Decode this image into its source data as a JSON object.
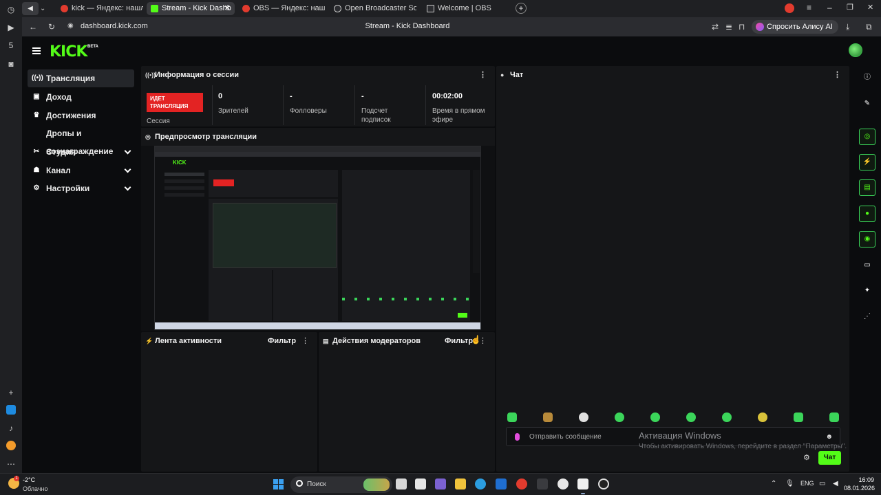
{
  "browser": {
    "tabs": [
      {
        "label": "kick — Яндекс: нашлось 1",
        "active": false
      },
      {
        "label": "Stream - Kick Dashb",
        "active": true
      },
      {
        "label": "OBS — Яндекс: нашлось 3",
        "active": false
      },
      {
        "label": "Open Broadcaster Softwa",
        "active": false
      },
      {
        "label": "Welcome | OBS",
        "active": false
      }
    ],
    "url": "dashboard.kick.com",
    "page_title": "Stream - Kick Dashboard",
    "alice_button": "Спросить Алису AI"
  },
  "header": {
    "logo": "KICK",
    "logo_badge": "BETA"
  },
  "sidebar": {
    "items": [
      {
        "label": "Трансляция",
        "icon": "broadcast-icon",
        "active": true,
        "expandable": false
      },
      {
        "label": "Доход",
        "icon": "revenue-icon",
        "active": false,
        "expandable": false
      },
      {
        "label": "Достижения",
        "icon": "trophy-icon",
        "active": false,
        "expandable": false
      },
      {
        "label": "Дропы и вознаграждение",
        "icon": "",
        "active": false,
        "expandable": false
      },
      {
        "label": "Студия",
        "icon": "studio-icon",
        "active": false,
        "expandable": true
      },
      {
        "label": "Канал",
        "icon": "channel-icon",
        "active": false,
        "expandable": true
      },
      {
        "label": "Настройки",
        "icon": "settings-icon",
        "active": false,
        "expandable": true
      }
    ]
  },
  "session": {
    "title": "Информация о сессии",
    "live_badge": "ИДЕТ ТРАНСЛЯЦИЯ",
    "session_label": "Сессия",
    "stats": [
      {
        "value": "0",
        "label": "Зрителей"
      },
      {
        "value": "-",
        "label": "Фолловеры"
      },
      {
        "value": "-",
        "label": "Подсчет подписок"
      },
      {
        "value": "00:02:00",
        "label": "Время в прямом эфире"
      }
    ]
  },
  "preview": {
    "title": "Предпросмотр трансляции"
  },
  "activity": {
    "title": "Лента активности",
    "filter": "Фильтр"
  },
  "moderators": {
    "title": "Действия модераторов",
    "filter": "Фильтр"
  },
  "chat": {
    "title": "Чат",
    "input_placeholder": "Отправить сообщение",
    "send_label": "Чат"
  },
  "windows_watermark": {
    "title": "Активация Windows",
    "subtitle": "Чтобы активировать Windows, перейдите в раздел \"Параметры\"."
  },
  "taskbar": {
    "weather_temp": "-2°C",
    "weather_desc": "Облачно",
    "weather_badge": "1",
    "search_label": "Поиск",
    "lang": "ENG",
    "time": "16:09",
    "date": "08.01.2026"
  },
  "colors": {
    "accent": "#53fc18",
    "live": "#e32323",
    "panel": "#151618",
    "background": "#0b0c0e"
  }
}
